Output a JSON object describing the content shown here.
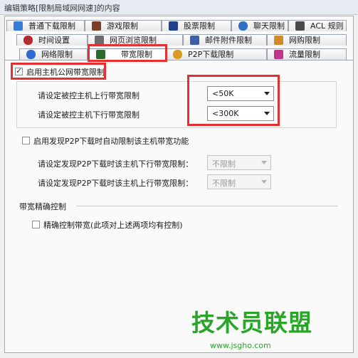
{
  "window": {
    "title": "编辑策略[限制局域网网速]的内容"
  },
  "tabs_row1": [
    {
      "label": "普通下载限制",
      "icon": "download-icon",
      "color": "#3a7bd5"
    },
    {
      "label": "游戏限制",
      "icon": "game-icon",
      "color": "#7a3f2a"
    },
    {
      "label": "股票限制",
      "icon": "stock-icon",
      "color": "#1f3f8f"
    },
    {
      "label": "聊天限制",
      "icon": "chat-icon",
      "color": "#2f6fc4"
    },
    {
      "label": "ACL 规则",
      "icon": "acl-icon",
      "color": "#4a4a4a"
    }
  ],
  "tabs_row2": [
    {
      "label": "时间设置",
      "icon": "clock-icon",
      "color": "#b32b2b"
    },
    {
      "label": "网页浏览限制",
      "icon": "browser-icon",
      "color": "#6b6b6b"
    },
    {
      "label": "邮件附件限制",
      "icon": "mail-icon",
      "color": "#3c5fa8"
    },
    {
      "label": "网购限制",
      "icon": "shop-icon",
      "color": "#d08a2a"
    }
  ],
  "tabs_row3": [
    {
      "label": "网络限制",
      "icon": "ie-icon",
      "color": "#2e6bd1"
    },
    {
      "label": "带宽限制",
      "icon": "bandwidth-icon",
      "color": "#2b6b2b"
    },
    {
      "label": "P2P下载限制",
      "icon": "p2p-icon",
      "color": "#d99a22"
    },
    {
      "label": "流量限制",
      "icon": "traffic-icon",
      "color": "#c2358e"
    }
  ],
  "bandwidth": {
    "enable_label": "启用主机公网带宽限制",
    "enable_checked": true,
    "upload_label": "请设定被控主机上行带宽限制",
    "upload_value": "<50K",
    "download_label": "请设定被控主机下行带宽限制",
    "download_value": "<300K"
  },
  "p2p": {
    "enable_label": "启用发现P2P下载时自动限制该主机带宽功能",
    "enable_checked": false,
    "down_label": "请设定发现P2P下载时该主机下行带宽限制：",
    "down_value": "不限制",
    "up_label": "请设定发现P2P下载时该主机上行带宽限制：",
    "up_value": "不限制"
  },
  "precise": {
    "section_label": "带宽精确控制",
    "checkbox_label": "精确控制带宽(此项对上述两项均有控制)",
    "checked": false
  },
  "watermark": {
    "brand": "技术员联盟",
    "url": "www.jsgho.com"
  },
  "colors": {
    "highlight": "#e53030",
    "watermark_green": "#2aa52a"
  }
}
